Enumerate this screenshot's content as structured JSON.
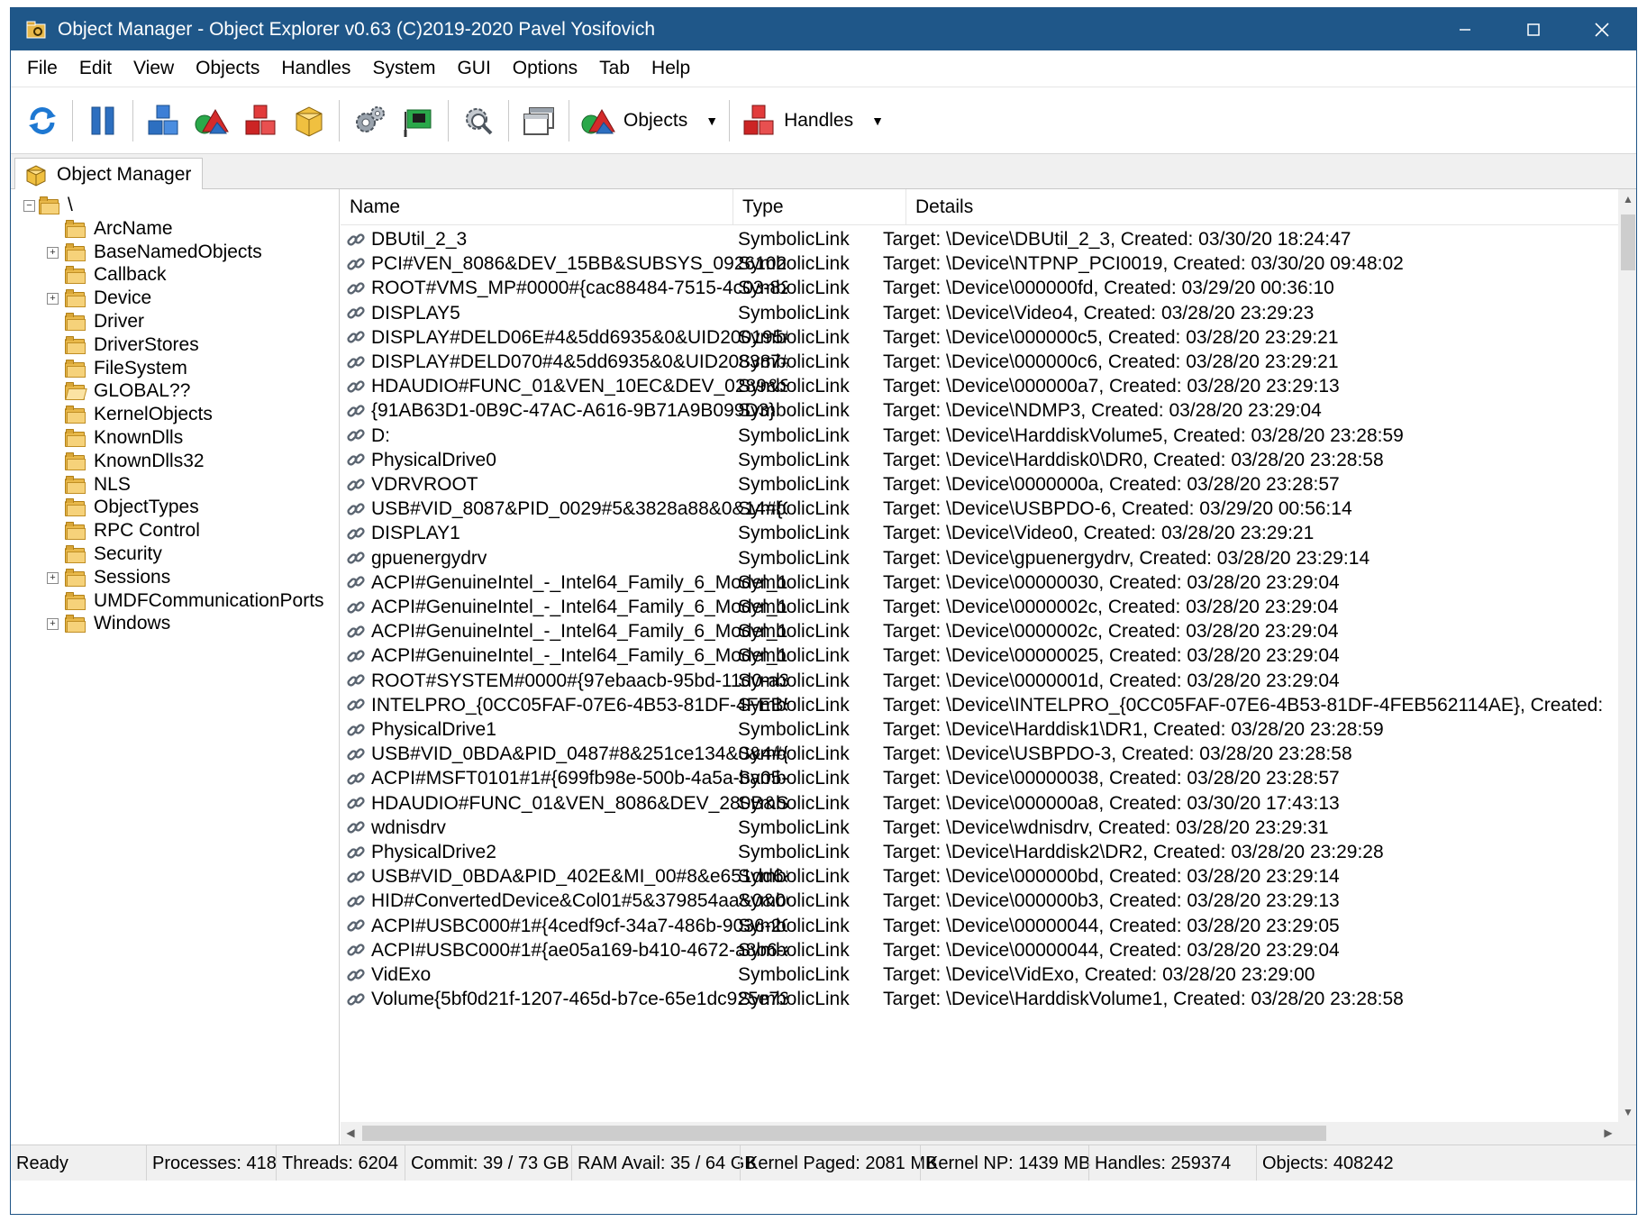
{
  "window": {
    "title": "Object Manager - Object Explorer v0.63 (C)2019-2020 Pavel Yosifovich",
    "controls": {
      "minimize": "─",
      "maximize": "☐",
      "close": "✕"
    }
  },
  "menu": [
    "File",
    "Edit",
    "View",
    "Objects",
    "Handles",
    "System",
    "GUI",
    "Options",
    "Tab",
    "Help"
  ],
  "toolbar": {
    "objects_label": "Objects",
    "handles_label": "Handles",
    "dropdown_arrow": "▼"
  },
  "tab": {
    "label": "Object Manager"
  },
  "tree": {
    "root": "\\",
    "items": [
      {
        "label": "ArcName",
        "expandable": false
      },
      {
        "label": "BaseNamedObjects",
        "expandable": true
      },
      {
        "label": "Callback",
        "expandable": false
      },
      {
        "label": "Device",
        "expandable": true
      },
      {
        "label": "Driver",
        "expandable": false
      },
      {
        "label": "DriverStores",
        "expandable": false
      },
      {
        "label": "FileSystem",
        "expandable": false
      },
      {
        "label": "GLOBAL??",
        "expandable": false,
        "selected": true
      },
      {
        "label": "KernelObjects",
        "expandable": false
      },
      {
        "label": "KnownDlls",
        "expandable": false
      },
      {
        "label": "KnownDlls32",
        "expandable": false
      },
      {
        "label": "NLS",
        "expandable": false
      },
      {
        "label": "ObjectTypes",
        "expandable": false
      },
      {
        "label": "RPC Control",
        "expandable": false
      },
      {
        "label": "Security",
        "expandable": false
      },
      {
        "label": "Sessions",
        "expandable": true
      },
      {
        "label": "UMDFCommunicationPorts",
        "expandable": false
      },
      {
        "label": "Windows",
        "expandable": true
      }
    ]
  },
  "list": {
    "columns": [
      "Name",
      "Type",
      "Details"
    ],
    "rows": [
      {
        "name": "DBUtil_2_3",
        "type": "SymbolicLink",
        "details": "Target: \\Device\\DBUtil_2_3, Created: 03/30/20 18:24:47"
      },
      {
        "name": "PCI#VEN_8086&DEV_15BB&SUBSYS_09261028&RE...",
        "type": "SymbolicLink",
        "details": "Target: \\Device\\NTPNP_PCI0019, Created: 03/30/20 09:48:02"
      },
      {
        "name": "ROOT#VMS_MP#0000#{cac88484-7515-4c03-82e6-...",
        "type": "SymbolicLink",
        "details": "Target: \\Device\\000000fd, Created: 03/29/20 00:36:10"
      },
      {
        "name": "DISPLAY5",
        "type": "SymbolicLink",
        "details": "Target: \\Device\\Video4, Created: 03/28/20 23:29:23"
      },
      {
        "name": "DISPLAY#DELD06E#4&5dd6935&0&UID200195#{8...",
        "type": "SymbolicLink",
        "details": "Target: \\Device\\000000c5, Created: 03/28/20 23:29:21"
      },
      {
        "name": "DISPLAY#DELD070#4&5dd6935&0&UID208387#{8...",
        "type": "SymbolicLink",
        "details": "Target: \\Device\\000000c6, Created: 03/28/20 23:29:21"
      },
      {
        "name": "HDAUDIO#FUNC_01&VEN_10EC&DEV_0289&SUB...",
        "type": "SymbolicLink",
        "details": "Target: \\Device\\000000a7, Created: 03/28/20 23:29:13"
      },
      {
        "name": "{91AB63D1-0B9C-47AC-A616-9B71A9B099D3}",
        "type": "SymbolicLink",
        "details": "Target: \\Device\\NDMP3, Created: 03/28/20 23:29:04"
      },
      {
        "name": "D:",
        "type": "SymbolicLink",
        "details": "Target: \\Device\\HarddiskVolume5, Created: 03/28/20 23:28:59"
      },
      {
        "name": "PhysicalDrive0",
        "type": "SymbolicLink",
        "details": "Target: \\Device\\Harddisk0\\DR0, Created: 03/28/20 23:28:58"
      },
      {
        "name": "VDRVROOT",
        "type": "SymbolicLink",
        "details": "Target: \\Device\\0000000a, Created: 03/28/20 23:28:57"
      },
      {
        "name": "USB#VID_8087&PID_0029#5&3828a88&0&14#{085...",
        "type": "SymbolicLink",
        "details": "Target: \\Device\\USBPDO-6, Created: 03/29/20 00:56:14"
      },
      {
        "name": "DISPLAY1",
        "type": "SymbolicLink",
        "details": "Target: \\Device\\Video0, Created: 03/28/20 23:29:21"
      },
      {
        "name": "gpuenergydrv",
        "type": "SymbolicLink",
        "details": "Target: \\Device\\gpuenergydrv, Created: 03/28/20 23:29:14"
      },
      {
        "name": "ACPI#GenuineIntel_-_Intel64_Family_6_Model_158...",
        "type": "SymbolicLink",
        "details": "Target: \\Device\\00000030, Created: 03/28/20 23:29:04"
      },
      {
        "name": "ACPI#GenuineIntel_-_Intel64_Family_6_Model_158...",
        "type": "SymbolicLink",
        "details": "Target: \\Device\\0000002c, Created: 03/28/20 23:29:04"
      },
      {
        "name": "ACPI#GenuineIntel_-_Intel64_Family_6_Model_158...",
        "type": "SymbolicLink",
        "details": "Target: \\Device\\0000002c, Created: 03/28/20 23:29:04"
      },
      {
        "name": "ACPI#GenuineIntel_-_Intel64_Family_6_Model_158...",
        "type": "SymbolicLink",
        "details": "Target: \\Device\\00000025, Created: 03/28/20 23:29:04"
      },
      {
        "name": "ROOT#SYSTEM#0000#{97ebaacb-95bd-11d0-a3ea-...",
        "type": "SymbolicLink",
        "details": "Target: \\Device\\0000001d, Created: 03/28/20 23:29:04"
      },
      {
        "name": "INTELPRO_{0CC05FAF-07E6-4B53-81DF-4FEB56211...",
        "type": "SymbolicLink",
        "details": "Target: \\Device\\INTELPRO_{0CC05FAF-07E6-4B53-81DF-4FEB562114AE}, Created:"
      },
      {
        "name": "PhysicalDrive1",
        "type": "SymbolicLink",
        "details": "Target: \\Device\\Harddisk1\\DR1, Created: 03/28/20 23:28:59"
      },
      {
        "name": "USB#VID_0BDA&PID_0487#8&251ce134&0&4#{f18...",
        "type": "SymbolicLink",
        "details": "Target: \\Device\\USBPDO-3, Created: 03/28/20 23:28:58"
      },
      {
        "name": "ACPI#MSFT0101#1#{699fb98e-500b-4a5a-ba05-5f2...",
        "type": "SymbolicLink",
        "details": "Target: \\Device\\00000038, Created: 03/28/20 23:28:57"
      },
      {
        "name": "HDAUDIO#FUNC_01&VEN_8086&DEV_280B&SUBS...",
        "type": "SymbolicLink",
        "details": "Target: \\Device\\000000a8, Created: 03/30/20 17:43:13"
      },
      {
        "name": "wdnisdrv",
        "type": "SymbolicLink",
        "details": "Target: \\Device\\wdnisdrv, Created: 03/28/20 23:29:31"
      },
      {
        "name": "PhysicalDrive2",
        "type": "SymbolicLink",
        "details": "Target: \\Device\\Harddisk2\\DR2, Created: 03/28/20 23:29:28"
      },
      {
        "name": "USB#VID_0BDA&PID_402E&MI_00#8&e651dd6&0...",
        "type": "SymbolicLink",
        "details": "Target: \\Device\\000000bd, Created: 03/28/20 23:29:14"
      },
      {
        "name": "HID#ConvertedDevice&Col01#5&379854aa&0&00...",
        "type": "SymbolicLink",
        "details": "Target: \\Device\\000000b3, Created: 03/28/20 23:29:13"
      },
      {
        "name": "ACPI#USBC000#1#{4cedf9cf-34a7-486b-9036-2081...",
        "type": "SymbolicLink",
        "details": "Target: \\Device\\00000044, Created: 03/28/20 23:29:05"
      },
      {
        "name": "ACPI#USBC000#1#{ae05a169-b410-4672-a8b6-a01...",
        "type": "SymbolicLink",
        "details": "Target: \\Device\\00000044, Created: 03/28/20 23:29:04"
      },
      {
        "name": "VidExo",
        "type": "SymbolicLink",
        "details": "Target: \\Device\\VidExo, Created: 03/28/20 23:29:00"
      },
      {
        "name": "Volume{5bf0d21f-1207-465d-b7ce-65e1dc925e73}",
        "type": "SymbolicLink",
        "details": "Target: \\Device\\HarddiskVolume1, Created: 03/28/20 23:28:58"
      }
    ]
  },
  "statusbar": {
    "ready": "Ready",
    "processes": "Processes: 418",
    "threads": "Threads: 6204",
    "commit": "Commit: 39 / 73 GB",
    "ram": "RAM Avail: 35 / 64 GB",
    "kernel_paged": "Kernel Paged: 2081 MB",
    "kernel_np": "Kernel NP: 1439 MB",
    "handles": "Handles: 259374",
    "objects": "Objects: 408242"
  },
  "colors": {
    "titlebar": "#1f5789",
    "folder": "#e8b84a",
    "selection": "#ffffff"
  }
}
